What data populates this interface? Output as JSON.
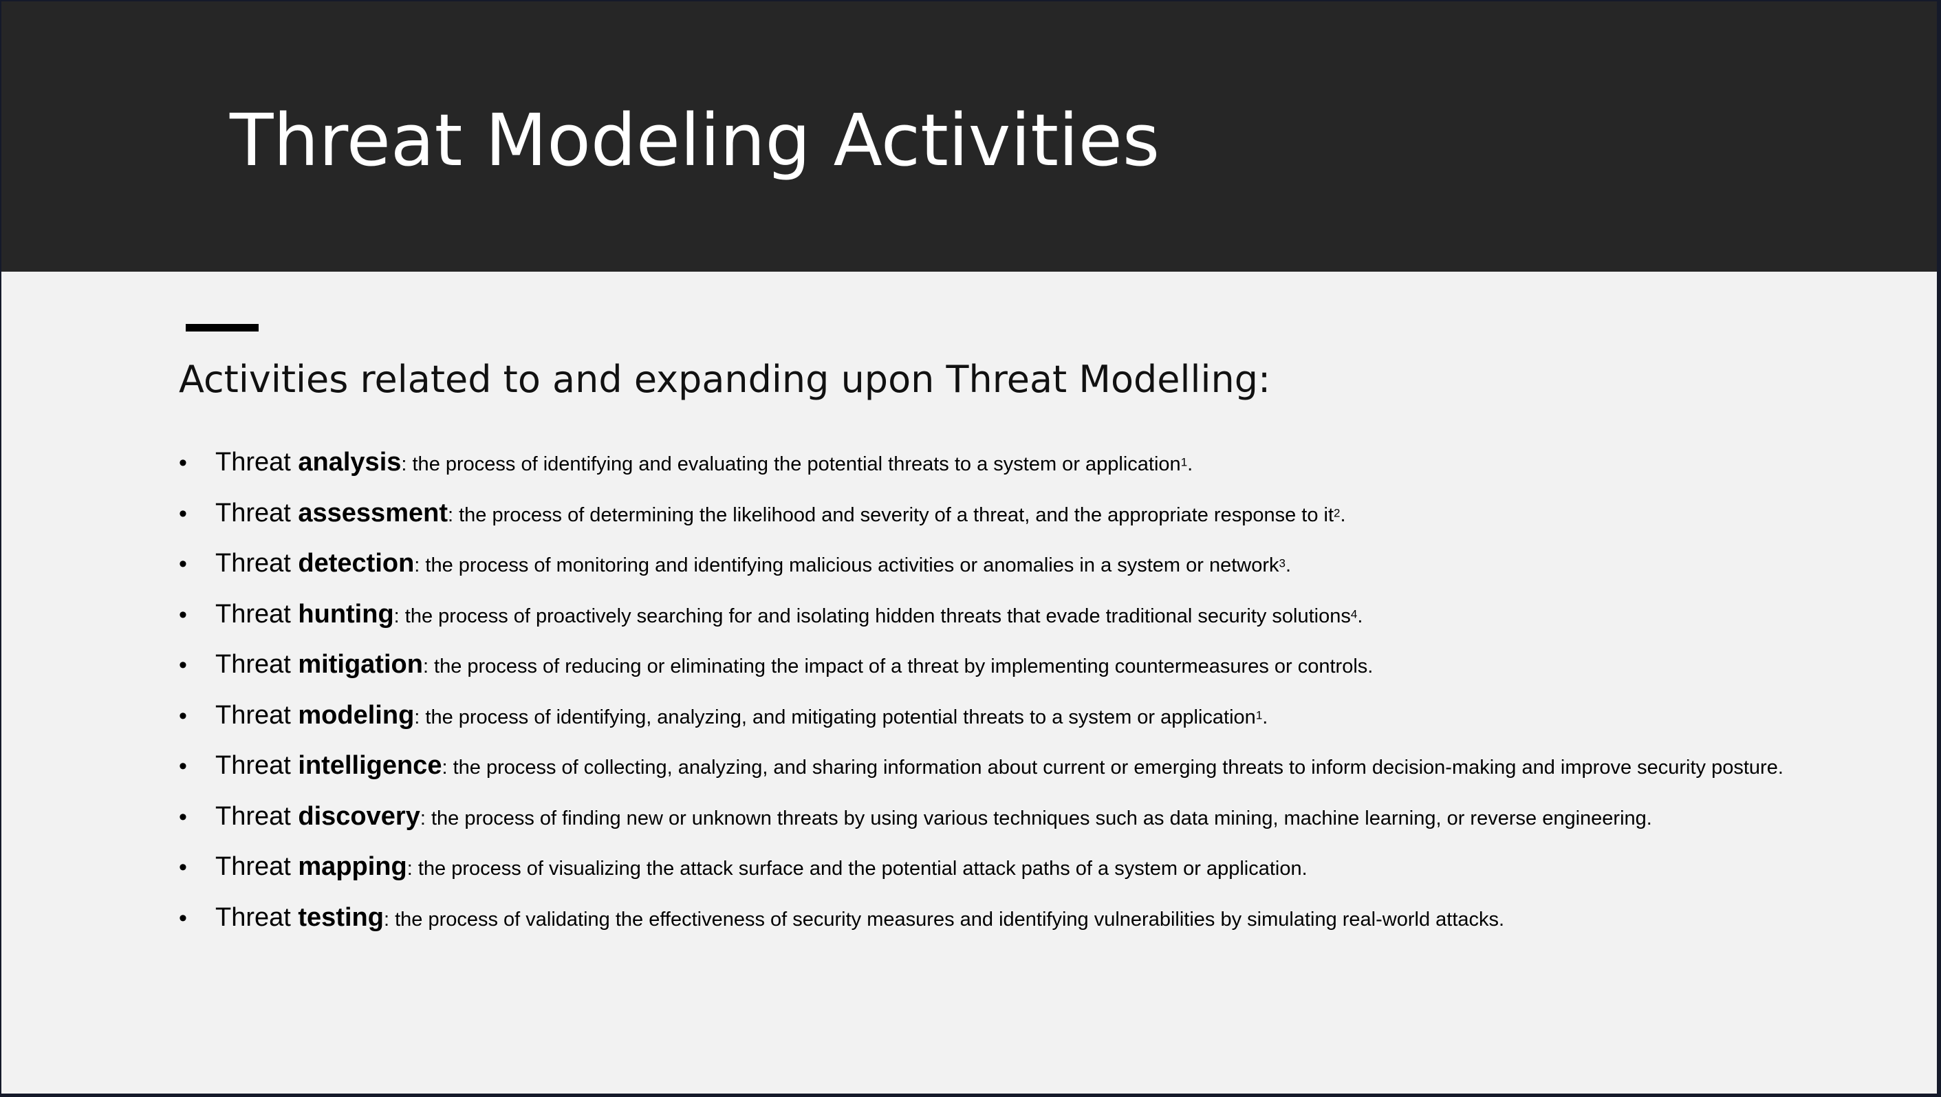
{
  "slide": {
    "title": "Threat Modeling Activities",
    "subtitle": "Activities related to and expanding upon Threat Modelling:",
    "bullet_glyph": "•",
    "items": [
      {
        "lead": "Threat ",
        "term": "analysis",
        "definition": ": the process of identifying and evaluating the potential threats to a system or application",
        "ref": "1",
        "end": "."
      },
      {
        "lead": "Threat ",
        "term": "assessment",
        "definition": ": the process of determining the likelihood and severity of a threat, and the appropriate response to it",
        "ref": "2",
        "end": "."
      },
      {
        "lead": "Threat ",
        "term": "detection",
        "definition": ": the process of monitoring and identifying malicious activities or anomalies in a system or network",
        "ref": "3",
        "end": "."
      },
      {
        "lead": "Threat ",
        "term": "hunting",
        "definition": ": the process of proactively searching for and isolating hidden threats that evade traditional security solutions",
        "ref": "4",
        "end": "."
      },
      {
        "lead": "Threat ",
        "term": "mitigation",
        "definition": ": the process of reducing or eliminating the impact of a threat by implementing countermeasures or controls.",
        "ref": "",
        "end": ""
      },
      {
        "lead": "Threat ",
        "term": "modeling",
        "definition": ": the process of identifying, analyzing, and mitigating potential threats to a system or application",
        "ref": "1",
        "end": "."
      },
      {
        "lead": "Threat ",
        "term": "intelligence",
        "definition": ": the process of collecting, analyzing, and sharing information about current or emerging threats to inform decision-making and improve security posture.",
        "ref": "",
        "end": ""
      },
      {
        "lead": "Threat ",
        "term": "discovery",
        "definition": ": the process of finding new or unknown threats by using various techniques such as data mining, machine learning, or reverse engineering.",
        "ref": "",
        "end": ""
      },
      {
        "lead": "Threat ",
        "term": "mapping",
        "definition": ": the process of visualizing the attack surface and the potential attack paths of a system or application.",
        "ref": "",
        "end": ""
      },
      {
        "lead": "Threat ",
        "term": "testing",
        "definition": ": the process of validating the effectiveness of security measures and identifying vulnerabilities by simulating real-world attacks.",
        "ref": "",
        "end": ""
      }
    ]
  },
  "colors": {
    "header_bg": "#262626",
    "body_bg": "#f2f2f2",
    "title_text": "#ffffff",
    "body_text": "#000000",
    "accent_bar": "#000000"
  }
}
